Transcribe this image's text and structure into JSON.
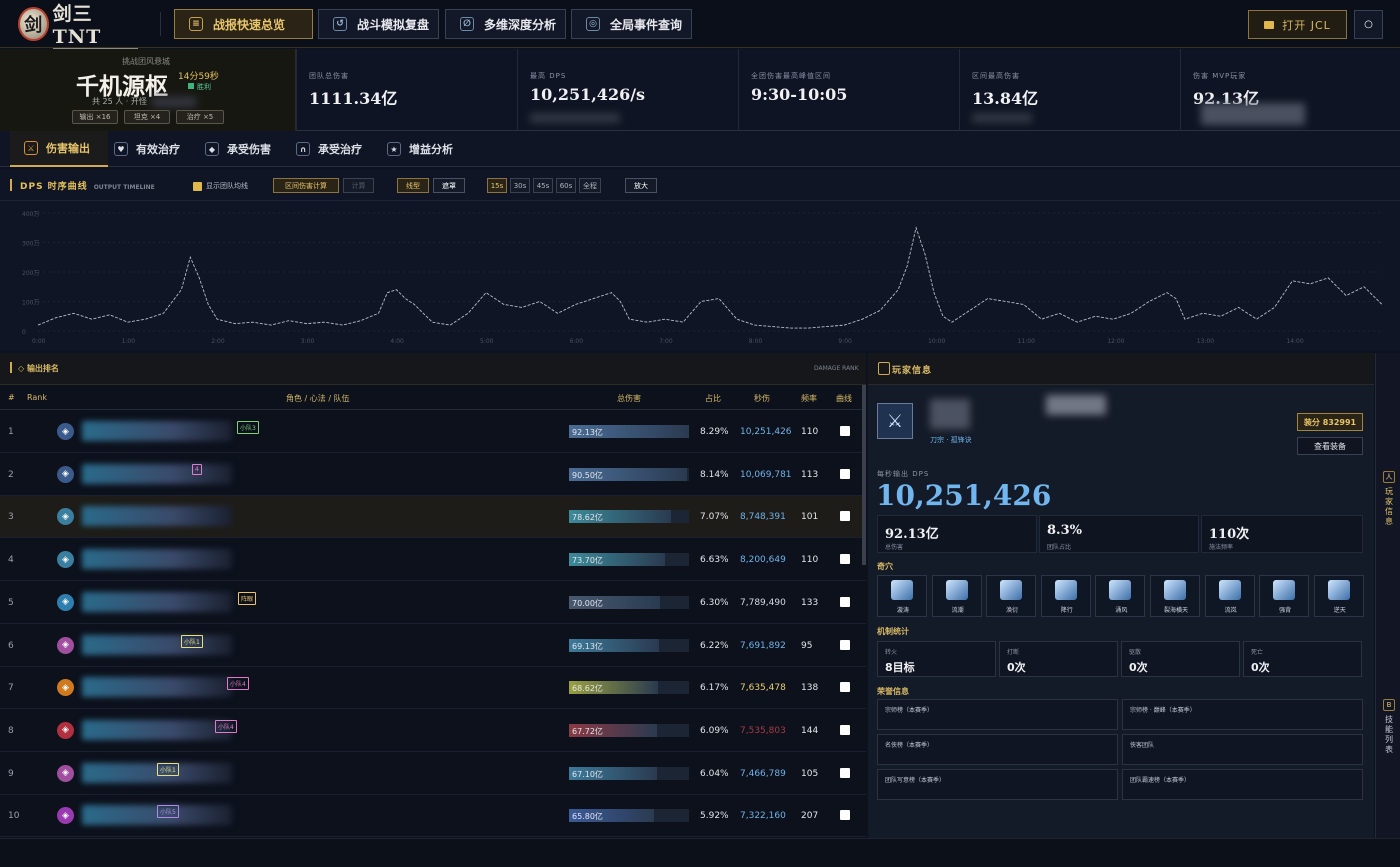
{
  "app": {
    "logo_text": "剑三 TNT"
  },
  "nav": [
    {
      "label": "战报快速总览",
      "icon": "overview-icon",
      "active": true
    },
    {
      "label": "战斗模拟复盘",
      "icon": "replay-icon",
      "active": false
    },
    {
      "label": "多维深度分析",
      "icon": "analysis-icon",
      "active": false
    },
    {
      "label": "全局事件查询",
      "icon": "query-icon",
      "active": false
    }
  ],
  "open_button": "打开 JCL",
  "boss": {
    "subtitle": "挑战团风悬城",
    "name": "千机源枢",
    "duration": "14分59秒",
    "result": "胜利",
    "people": "共 25 人 · 开怪",
    "pills": [
      "输出 ×16",
      "坦克 ×4",
      "治疗 ×5"
    ]
  },
  "stats": [
    {
      "label": "团队总伤害",
      "value": "1111.34亿"
    },
    {
      "label": "最高 DPS",
      "value": "10,251,426/s"
    },
    {
      "label": "全团伤害最高峰值区间",
      "value": "9:30-10:05"
    },
    {
      "label": "区间最高伤害",
      "value": "13.84亿"
    },
    {
      "label": "伤害 MVP玩家",
      "value": "92.13亿"
    }
  ],
  "tabs": [
    {
      "label": "伤害输出",
      "active": true
    },
    {
      "label": "有效治疗",
      "active": false
    },
    {
      "label": "承受伤害",
      "active": false
    },
    {
      "label": "承受治疗",
      "active": false
    },
    {
      "label": "增益分析",
      "active": false
    }
  ],
  "dps_chart": {
    "title": "DPS 时序曲线",
    "title_en": "OUTPUT TIMELINE",
    "show_avg": "显示团队均线",
    "range_calc": "区间伤害计算",
    "calc": "计算",
    "line_type": "线型",
    "mask": "遮罩",
    "windows": [
      "15s",
      "30s",
      "45s",
      "60s",
      "全程"
    ],
    "zoom": "放大"
  },
  "chart_data": {
    "type": "line",
    "title": "DPS 时序曲线",
    "x_ticks": [
      "0:00",
      "1:00",
      "2:00",
      "3:00",
      "4:00",
      "5:00",
      "6:00",
      "7:00",
      "8:00",
      "9:00",
      "10:00",
      "11:00",
      "12:00",
      "13:00",
      "14:00"
    ],
    "y_ticks": [
      "0",
      "100万",
      "200万",
      "300万",
      "400万"
    ],
    "ylim": [
      0,
      400
    ],
    "xlim": [
      0,
      15
    ],
    "series": [
      {
        "values": [
          [
            0.0,
            20
          ],
          [
            0.2,
            45
          ],
          [
            0.4,
            60
          ],
          [
            0.6,
            40
          ],
          [
            0.8,
            55
          ],
          [
            1.0,
            30
          ],
          [
            1.2,
            40
          ],
          [
            1.4,
            60
          ],
          [
            1.6,
            140
          ],
          [
            1.7,
            250
          ],
          [
            1.8,
            180
          ],
          [
            1.9,
            90
          ],
          [
            2.0,
            40
          ],
          [
            2.2,
            25
          ],
          [
            2.4,
            30
          ],
          [
            2.6,
            20
          ],
          [
            2.8,
            35
          ],
          [
            3.0,
            25
          ],
          [
            3.2,
            30
          ],
          [
            3.4,
            20
          ],
          [
            3.6,
            35
          ],
          [
            3.8,
            60
          ],
          [
            3.9,
            130
          ],
          [
            4.0,
            140
          ],
          [
            4.1,
            110
          ],
          [
            4.2,
            90
          ],
          [
            4.4,
            30
          ],
          [
            4.6,
            20
          ],
          [
            4.8,
            60
          ],
          [
            5.0,
            130
          ],
          [
            5.2,
            90
          ],
          [
            5.4,
            80
          ],
          [
            5.6,
            100
          ],
          [
            5.8,
            60
          ],
          [
            6.0,
            90
          ],
          [
            6.2,
            110
          ],
          [
            6.4,
            130
          ],
          [
            6.5,
            100
          ],
          [
            6.6,
            40
          ],
          [
            6.8,
            30
          ],
          [
            7.0,
            40
          ],
          [
            7.2,
            30
          ],
          [
            7.4,
            100
          ],
          [
            7.6,
            110
          ],
          [
            7.8,
            40
          ],
          [
            8.0,
            20
          ],
          [
            8.2,
            15
          ],
          [
            8.4,
            10
          ],
          [
            8.6,
            10
          ],
          [
            8.8,
            15
          ],
          [
            9.0,
            20
          ],
          [
            9.2,
            40
          ],
          [
            9.4,
            70
          ],
          [
            9.6,
            140
          ],
          [
            9.7,
            220
          ],
          [
            9.8,
            350
          ],
          [
            9.9,
            260
          ],
          [
            10.0,
            130
          ],
          [
            10.1,
            50
          ],
          [
            10.2,
            30
          ],
          [
            10.4,
            70
          ],
          [
            10.6,
            110
          ],
          [
            10.8,
            100
          ],
          [
            11.0,
            90
          ],
          [
            11.2,
            40
          ],
          [
            11.4,
            60
          ],
          [
            11.6,
            30
          ],
          [
            11.8,
            50
          ],
          [
            12.0,
            40
          ],
          [
            12.2,
            60
          ],
          [
            12.4,
            100
          ],
          [
            12.6,
            130
          ],
          [
            12.7,
            110
          ],
          [
            12.8,
            40
          ],
          [
            13.0,
            60
          ],
          [
            13.2,
            50
          ],
          [
            13.4,
            80
          ],
          [
            13.6,
            40
          ],
          [
            13.8,
            80
          ],
          [
            14.0,
            170
          ],
          [
            14.2,
            160
          ],
          [
            14.4,
            180
          ],
          [
            14.6,
            120
          ],
          [
            14.8,
            150
          ],
          [
            15.0,
            90
          ]
        ]
      }
    ]
  },
  "rank": {
    "title": "输出排名",
    "title_en": "DAMAGE RANK",
    "headers": {
      "idx": "#",
      "rank": "Rank",
      "role": "角色 / 心法 / 队伍",
      "total": "总伤害",
      "pct": "占比",
      "dps": "秒伤",
      "freq": "频率",
      "curve": "曲线"
    },
    "rows": [
      {
        "n": "1",
        "icon_color": "#3b5a8c",
        "total": "92.13亿",
        "fill": 1.0,
        "bar_color": "#4a6d96",
        "pct": "8.29%",
        "dps": "10,251,426",
        "dps_color": "#6fb3e8",
        "freq": "110",
        "tag": "小队3",
        "tag_left": 237,
        "tag_color": "#7fd07a"
      },
      {
        "n": "2",
        "icon_color": "#3b5a8c",
        "total": "90.50亿",
        "fill": 0.98,
        "bar_color": "#4a6d96",
        "pct": "8.14%",
        "dps": "10,069,781",
        "dps_color": "#6fb3e8",
        "freq": "113",
        "tag": "4",
        "tag_left": 192,
        "tag_color": "#e07acb"
      },
      {
        "n": "3",
        "icon_color": "#3a7ea0",
        "total": "78.62亿",
        "fill": 0.85,
        "bar_color": "#3c8a9a",
        "pct": "7.07%",
        "dps": "8,748,391",
        "dps_color": "#6fb3e8",
        "freq": "101",
        "tag": "",
        "tag_left": 0,
        "tag_color": "#888"
      },
      {
        "n": "4",
        "icon_color": "#3a7ea0",
        "total": "73.70亿",
        "fill": 0.8,
        "bar_color": "#3c8a9a",
        "pct": "6.63%",
        "dps": "8,200,649",
        "dps_color": "#6fb3e8",
        "freq": "110",
        "tag": "",
        "tag_left": 0,
        "tag_color": "#888"
      },
      {
        "n": "5",
        "icon_color": "#2e7fb0",
        "total": "70.00亿",
        "fill": 0.76,
        "bar_color": "#48586e",
        "pct": "6.30%",
        "dps": "7,789,490",
        "dps_color": "#d6dae2",
        "freq": "133",
        "tag": "阵眼",
        "tag_left": 238,
        "tag_color": "#e8c46a"
      },
      {
        "n": "6",
        "icon_color": "#a04fa0",
        "total": "69.13亿",
        "fill": 0.75,
        "bar_color": "#3c7a9a",
        "pct": "6.22%",
        "dps": "7,691,892",
        "dps_color": "#6fb3e8",
        "freq": "95",
        "tag": "小队1",
        "tag_left": 181,
        "tag_color": "#e8e07a"
      },
      {
        "n": "7",
        "icon_color": "#d07a20",
        "total": "68.62亿",
        "fill": 0.74,
        "bar_color": "#9aa040",
        "pct": "6.17%",
        "dps": "7,635,478",
        "dps_color": "#e8d070",
        "freq": "138",
        "tag": "小队4",
        "tag_left": 227,
        "tag_color": "#e07acb"
      },
      {
        "n": "8",
        "icon_color": "#b03040",
        "total": "67.72亿",
        "fill": 0.73,
        "bar_color": "#8a3a44",
        "pct": "6.09%",
        "dps": "7,535,803",
        "dps_color": "#a83a44",
        "freq": "144",
        "tag": "小队4",
        "tag_left": 215,
        "tag_color": "#e07acb"
      },
      {
        "n": "9",
        "icon_color": "#a04fa0",
        "total": "67.10亿",
        "fill": 0.73,
        "bar_color": "#3c7a9a",
        "pct": "6.04%",
        "dps": "7,466,789",
        "dps_color": "#6fb3e8",
        "freq": "105",
        "tag": "小队1",
        "tag_left": 157,
        "tag_color": "#e8e07a"
      },
      {
        "n": "10",
        "icon_color": "#9a3ab0",
        "total": "65.80亿",
        "fill": 0.71,
        "bar_color": "#3a5a9a",
        "pct": "5.92%",
        "dps": "7,322,160",
        "dps_color": "#6fb3e8",
        "freq": "207",
        "tag": "小队5",
        "tag_left": 157,
        "tag_color": "#b08ae8"
      }
    ]
  },
  "player": {
    "title": "玩家信息",
    "school": "刀宗 · 孤锋诀",
    "gear_score": "装分 832991",
    "view_gear": "查看装备",
    "dps_label": "每秒输出 DPS",
    "dps": "10,251,426",
    "mini": [
      {
        "value": "92.13亿",
        "label": "总伤害"
      },
      {
        "value": "8.3%",
        "label": "团队占比"
      },
      {
        "value": "110次",
        "label": "施法频率"
      }
    ],
    "qixue_title": "奇穴",
    "qixue": [
      "漩涛",
      "流潮",
      "涣衍",
      "降行",
      "涌风",
      "裂海横天",
      "流岚",
      "强背",
      "逆天"
    ],
    "mech_title": "机制统计",
    "mech": [
      {
        "label": "转火",
        "value": "8目标"
      },
      {
        "label": "打断",
        "value": "0次"
      },
      {
        "label": "驱散",
        "value": "0次"
      },
      {
        "label": "死亡",
        "value": "0次"
      }
    ],
    "honor_title": "荣誉信息",
    "honor": [
      "宗师榜（本赛季）",
      "宗师榜 · 巅峰（本赛季）",
      "名侠榜（本赛季）",
      "侠客团队",
      "团队写意榜（本赛季）",
      "团队霸速榜（本赛季）"
    ]
  },
  "side_tabs": [
    {
      "label": "玩家信息",
      "active": true
    },
    {
      "label": "技能列表",
      "active": false
    }
  ]
}
